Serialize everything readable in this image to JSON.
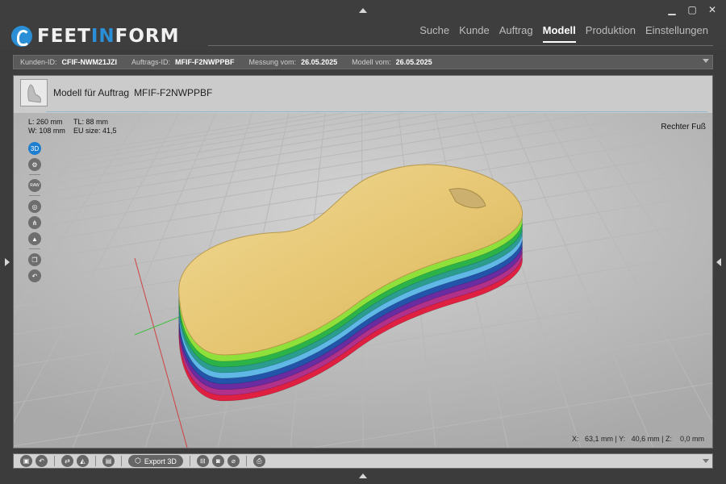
{
  "app": {
    "logo_part1": "FEET",
    "logo_part2": "IN",
    "logo_part3": "FORM",
    "logo_icon": "foot-logo-icon",
    "window_controls": [
      "minimize-icon",
      "maximize-icon",
      "close-icon"
    ]
  },
  "nav": {
    "tabs": [
      {
        "label": "Suche",
        "active": false
      },
      {
        "label": "Kunde",
        "active": false
      },
      {
        "label": "Auftrag",
        "active": false
      },
      {
        "label": "Modell",
        "active": true
      },
      {
        "label": "Produktion",
        "active": false
      },
      {
        "label": "Einstellungen",
        "active": false
      }
    ]
  },
  "info": {
    "customer_label": "Kunden-ID:",
    "customer_value": "CFIF-NWM21JZI",
    "order_label": "Auftrags-ID:",
    "order_value": "MFIF-F2NWPPBF",
    "measure_label": "Messung vom:",
    "measure_value": "26.05.2025",
    "model_label": "Modell vom:",
    "model_value": "26.05.2025"
  },
  "model": {
    "title": "Modell für Auftrag",
    "order_id": "MFIF-F2NWPPBF",
    "dim_l": "L: 260 mm",
    "dim_tl": "TL: 88 mm",
    "dim_w": "W: 108 mm",
    "dim_eu": "EU size: 41,5",
    "side": "Rechter Fuß",
    "coords": "X:   63,1 mm | Y:   40,6 mm | Z:    0,0 mm"
  },
  "tools": [
    {
      "name": "view-3d-button",
      "label": "3D",
      "icon": "3d-icon",
      "active": true
    },
    {
      "name": "settings-button",
      "label": "⚙",
      "icon": "gear-icon",
      "active": false
    },
    {
      "name": "raw-button",
      "label": "RAW",
      "icon": "raw-icon",
      "active": false
    },
    {
      "name": "compass-button",
      "label": "◎",
      "icon": "compass-icon",
      "active": false
    },
    {
      "name": "tree-button",
      "label": "⋔",
      "icon": "branch-icon",
      "active": false
    },
    {
      "name": "layers-button",
      "label": "▲",
      "icon": "stack-icon",
      "active": false
    },
    {
      "name": "copy-button",
      "label": "❐",
      "icon": "copy-icon",
      "active": false
    },
    {
      "name": "undo-button",
      "label": "↶",
      "icon": "undo-icon",
      "active": false
    }
  ],
  "bottom": {
    "export_label": "Export 3D",
    "export_icon": "cube-icon"
  },
  "colors": {
    "accent": "#1e7fd0",
    "layers": [
      "#8ee03a",
      "#2bb34a",
      "#2a9d8f",
      "#5fb8e6",
      "#2255aa",
      "#6a2ca0",
      "#b0308a",
      "#e02040"
    ],
    "insole_top": "#e9c97a"
  }
}
